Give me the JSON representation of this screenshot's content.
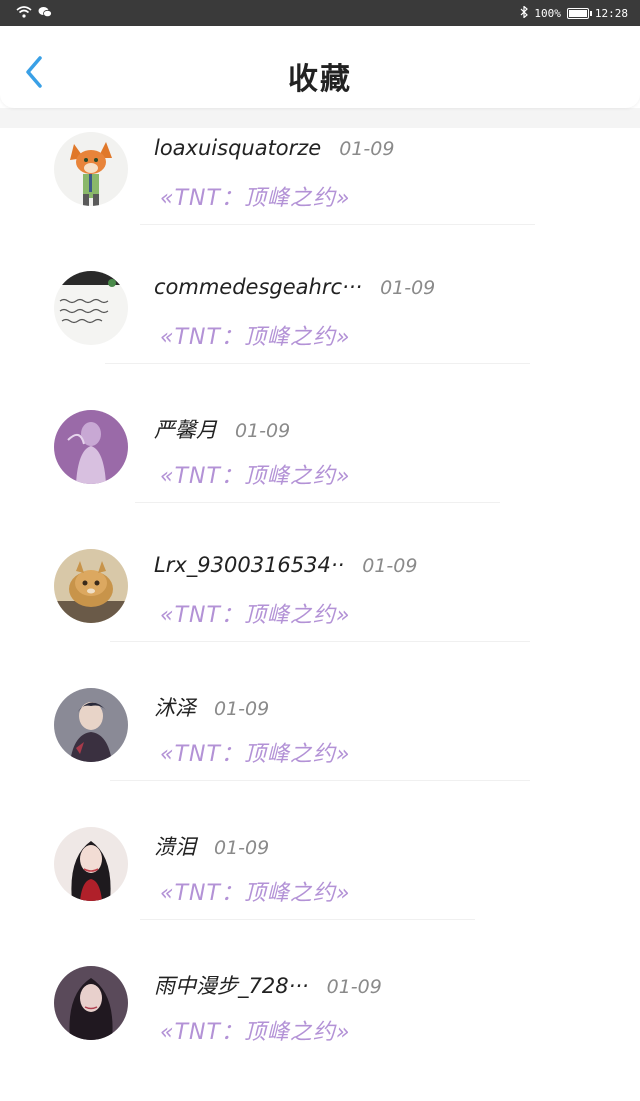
{
  "status_bar": {
    "battery": "100%",
    "time": "12:28"
  },
  "header": {
    "title": "收藏"
  },
  "favorites": [
    {
      "user": "loaxuisquatorze",
      "date": "01-09",
      "title": "«TNT：顶峰之约»",
      "avatar": "fox-cartoon-icon"
    },
    {
      "user": "commedesgeahrc···",
      "date": "01-09",
      "title": "«TNT：顶峰之约»",
      "avatar": "handwriting-note-icon"
    },
    {
      "user": "严馨月",
      "date": "01-09",
      "title": "«TNT：顶峰之约»",
      "avatar": "purple-portrait-icon"
    },
    {
      "user": "Lrx_9300316534··",
      "date": "01-09",
      "title": "«TNT：顶峰之约»",
      "avatar": "cat-icon"
    },
    {
      "user": "沭泽",
      "date": "01-09",
      "title": "«TNT：顶峰之约»",
      "avatar": "boy-portrait-icon"
    },
    {
      "user": "溃泪",
      "date": "01-09",
      "title": "«TNT：顶峰之约»",
      "avatar": "girl-portrait-icon"
    },
    {
      "user": "雨中漫步_728···",
      "date": "01-09",
      "title": "«TNT：顶峰之约»",
      "avatar": "girl-portrait-dark-icon"
    }
  ],
  "colors": {
    "accent": "#3aa0e6",
    "title_purple": "#b392d6"
  }
}
